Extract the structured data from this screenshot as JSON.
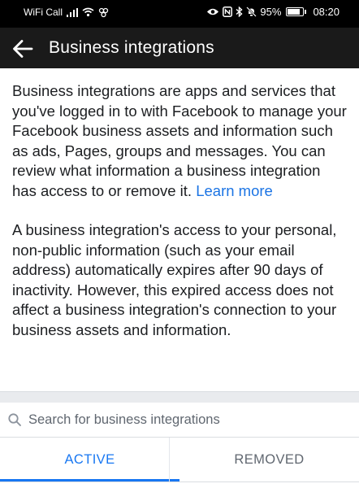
{
  "status_bar": {
    "carrier": "WiFi Call",
    "battery": "95%",
    "time": "08:20"
  },
  "header": {
    "title": "Business integrations",
    "back_icon": "arrow-left-icon"
  },
  "description": {
    "paragraph1": "Business integrations are apps and services that you've logged in to with Facebook to manage your Facebook business assets and information such as ads, Pages, groups and messages. You can review what information a business integration has access to or remove it.",
    "learn_more": "Learn more",
    "paragraph2": "A business integration's access to your personal, non-public information (such as your email address) automatically expires after 90 days of inactivity. However, this expired access does not affect a business integration's connection to your business assets and information."
  },
  "search": {
    "placeholder": "Search for business integrations",
    "value": ""
  },
  "tabs": [
    {
      "label": "ACTIVE",
      "active": true
    },
    {
      "label": "REMOVED",
      "active": false
    }
  ],
  "colors": {
    "accent": "#1877f2",
    "link": "#1b74e4",
    "appbar": "#1a1a1a",
    "statusbar": "#000000"
  }
}
